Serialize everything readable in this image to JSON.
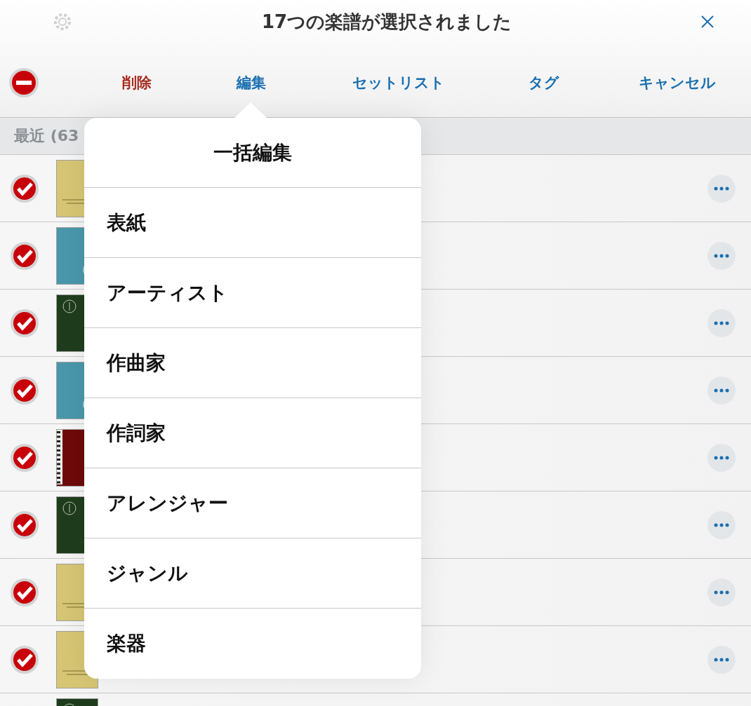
{
  "header": {
    "title": "17つの楽譜が選択されました"
  },
  "toolbar": {
    "actions": [
      {
        "label": "削除",
        "kind": "destructive"
      },
      {
        "label": "編集",
        "kind": "normal"
      },
      {
        "label": "セットリスト",
        "kind": "normal"
      },
      {
        "label": "タグ",
        "kind": "normal"
      },
      {
        "label": "キャンセル",
        "kind": "normal"
      }
    ]
  },
  "section": {
    "title": "最近 (63"
  },
  "rows": [
    {
      "checked": true,
      "cover": {
        "kind": "staff",
        "color": "#d6c674"
      }
    },
    {
      "checked": true,
      "cover": {
        "kind": "swirl",
        "color": "#4a97ab"
      }
    },
    {
      "checked": true,
      "cover": {
        "kind": "treble",
        "color": "#1f3d1c"
      }
    },
    {
      "checked": true,
      "cover": {
        "kind": "swirl",
        "color": "#4a97ab"
      }
    },
    {
      "checked": true,
      "cover": {
        "kind": "keyboard",
        "color": "#6e0a0a"
      }
    },
    {
      "checked": true,
      "cover": {
        "kind": "treble",
        "color": "#1f3d1c"
      }
    },
    {
      "checked": true,
      "cover": {
        "kind": "staff",
        "color": "#d6c674"
      }
    },
    {
      "checked": true,
      "cover": {
        "kind": "staff",
        "color": "#d6c674"
      }
    }
  ],
  "partial_row": {
    "cover": {
      "kind": "treble",
      "color": "#1f3d1c"
    }
  },
  "popover": {
    "title": "一括編集",
    "items": [
      "表紙",
      "アーティスト",
      "作曲家",
      "作詞家",
      "アレンジャー",
      "ジャンル",
      "楽器"
    ]
  }
}
